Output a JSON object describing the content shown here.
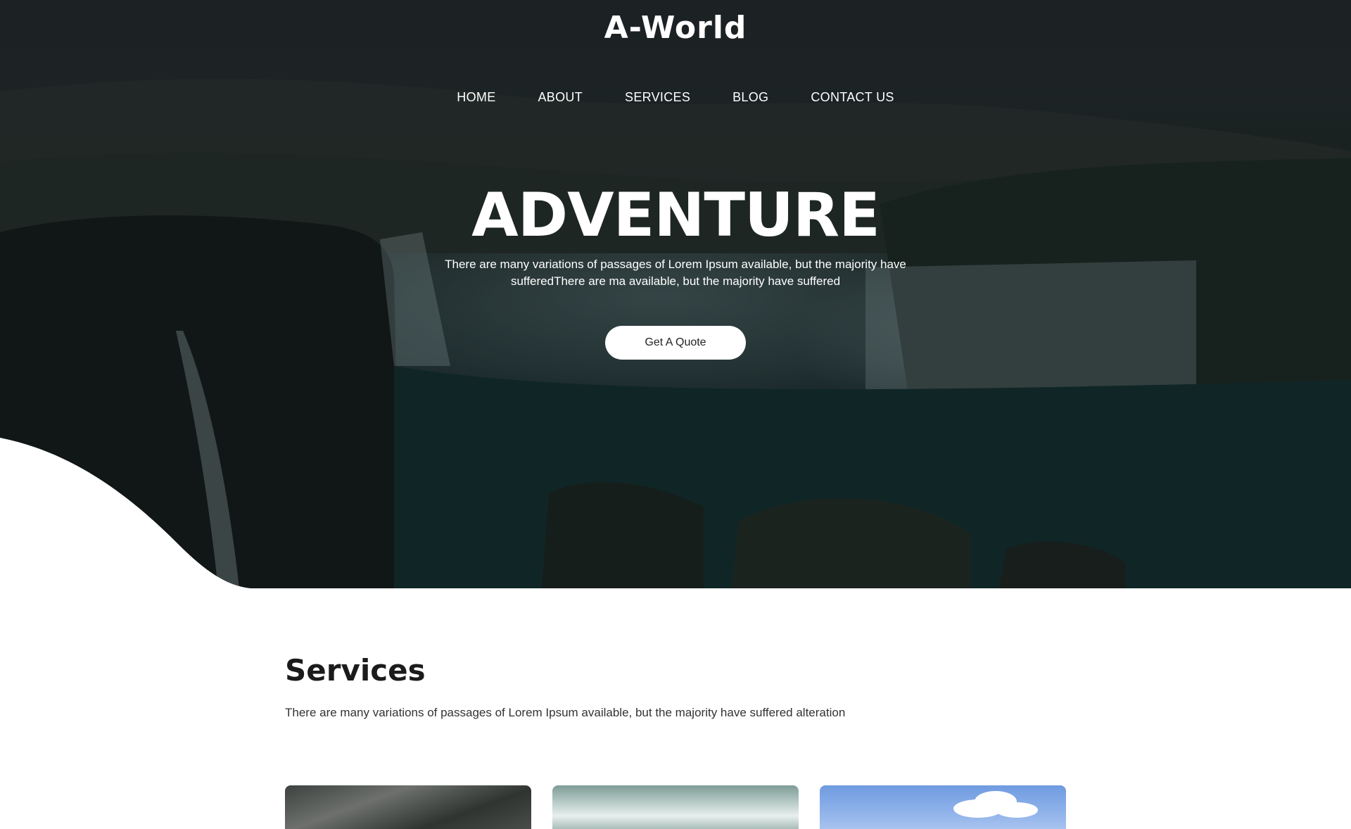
{
  "header": {
    "logo": "A-World",
    "nav": [
      "HOME",
      "ABOUT",
      "SERVICES",
      "BLOG",
      "CONTACT US"
    ]
  },
  "hero": {
    "title": "ADVENTURE",
    "text": "There are many variations of passages of Lorem Ipsum available, but the majority have sufferedThere are ma available, but the majority have suffered",
    "button": "Get A Quote"
  },
  "services": {
    "title": "Services",
    "text": "There are many variations of passages of Lorem Ipsum available, but the majority have suffered alteration"
  }
}
